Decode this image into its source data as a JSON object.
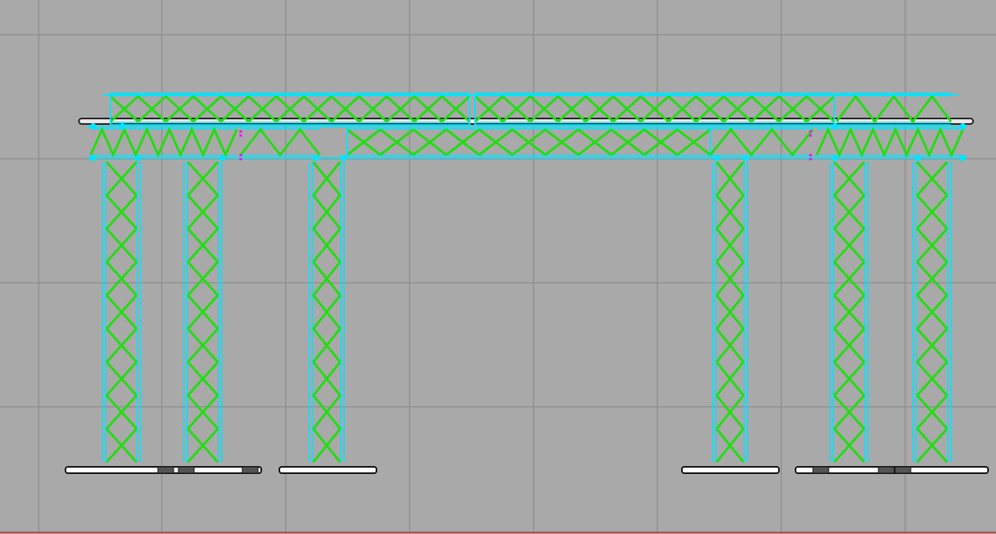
{
  "viewport": {
    "view_name": "",
    "background": "#a9a9a9",
    "grid_color": "#8f8f8f",
    "grid_on": true,
    "bottom_rule_color": "#b94a4a"
  },
  "colors": {
    "truss_chord": "#00e5ff",
    "truss_lacing": "#22dd11",
    "highlight": "#ff00ff",
    "baseplate_fill": "#ffffff",
    "baseplate_stroke": "#111111",
    "pipe": "#222222"
  },
  "model": {
    "type": "truss-structure-elevation",
    "header_truss_segments": 2,
    "lower_truss_modules": 5,
    "columns": 6,
    "base_plates": 5
  }
}
